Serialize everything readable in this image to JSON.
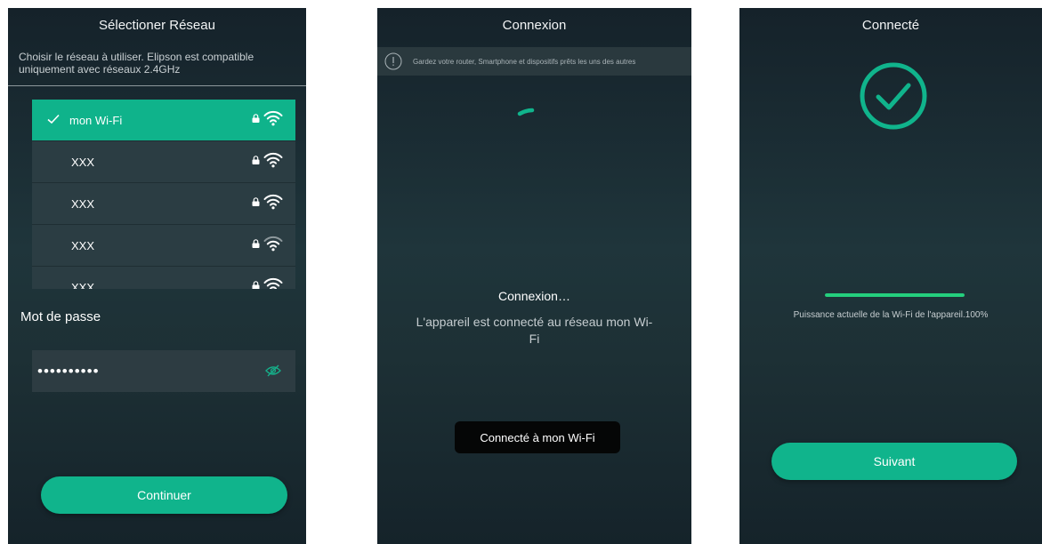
{
  "screen1": {
    "title": "Sélectioner Réseau",
    "description": "Choisir le réseau à utiliser. Elipson est compatible uniquement avec réseaux 2.4GHz",
    "networks": [
      {
        "name": "mon Wi-Fi",
        "selected": true
      },
      {
        "name": "XXX",
        "selected": false
      },
      {
        "name": "XXX",
        "selected": false
      },
      {
        "name": "XXX",
        "selected": false
      },
      {
        "name": "XXX",
        "selected": false
      }
    ],
    "password_label": "Mot de passe",
    "password_value": "••••••••••",
    "continue_label": "Continuer"
  },
  "screen2": {
    "title": "Connexion",
    "notice": "Gardez votre router, Smartphone et dispositifs prêts les uns des autres",
    "status_title": "Connexion…",
    "status_message": "L'appareil est connecté au réseau mon Wi-Fi",
    "toast": "Connecté à mon Wi-Fi"
  },
  "screen3": {
    "title": "Connecté",
    "strength_text": "Puissance actuelle de la Wi-Fi de l'appareil.100%",
    "strength_percent": 100,
    "next_label": "Suivant"
  },
  "colors": {
    "accent": "#10b48c",
    "progress": "#24cf7d",
    "background": "#1f353b"
  },
  "icons": [
    "checkmark-icon",
    "lock-icon",
    "wifi-icon",
    "eye-icon",
    "info-icon",
    "spinner-icon",
    "success-check-icon"
  ]
}
